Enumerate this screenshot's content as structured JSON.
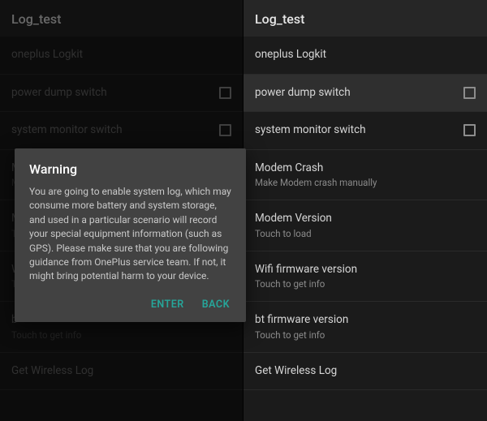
{
  "left": {
    "title": "Log_test",
    "rows": [
      {
        "label": "oneplus Logkit",
        "sub": null,
        "checkbox": false
      },
      {
        "label": "power dump switch",
        "sub": null,
        "checkbox": true
      },
      {
        "label": "system monitor switch",
        "sub": null,
        "checkbox": true
      },
      {
        "label": "M",
        "sub": "M",
        "checkbox": false
      },
      {
        "label": "M",
        "sub": "To",
        "checkbox": false
      },
      {
        "label": "W",
        "sub": "To",
        "checkbox": false
      },
      {
        "label": "b",
        "sub": "Touch to get info",
        "checkbox": false
      },
      {
        "label": "Get Wireless Log",
        "sub": null,
        "checkbox": false
      }
    ],
    "dialog": {
      "title": "Warning",
      "body": "You are going to enable system log, which may consume more battery and system storage, and used in a particular scenario will record your special equipment information (such as GPS). Please make sure that you are following guidance from OnePlus service team. If not, it might bring potential harm to your device.",
      "enter": "ENTER",
      "back": "BACK"
    }
  },
  "right": {
    "title": "Log_test",
    "rows": [
      {
        "label": "oneplus Logkit",
        "sub": null,
        "checkbox": false
      },
      {
        "label": "power dump switch",
        "sub": null,
        "checkbox": true
      },
      {
        "label": "system monitor switch",
        "sub": null,
        "checkbox": true
      },
      {
        "label": "Modem Crash",
        "sub": "Make Modem crash manually",
        "checkbox": false
      },
      {
        "label": "Modem Version",
        "sub": "Touch to load",
        "checkbox": false
      },
      {
        "label": "Wifi firmware version",
        "sub": "Touch to get info",
        "checkbox": false
      },
      {
        "label": "bt firmware version",
        "sub": "Touch to get info",
        "checkbox": false
      },
      {
        "label": "Get Wireless Log",
        "sub": null,
        "checkbox": false
      }
    ]
  }
}
